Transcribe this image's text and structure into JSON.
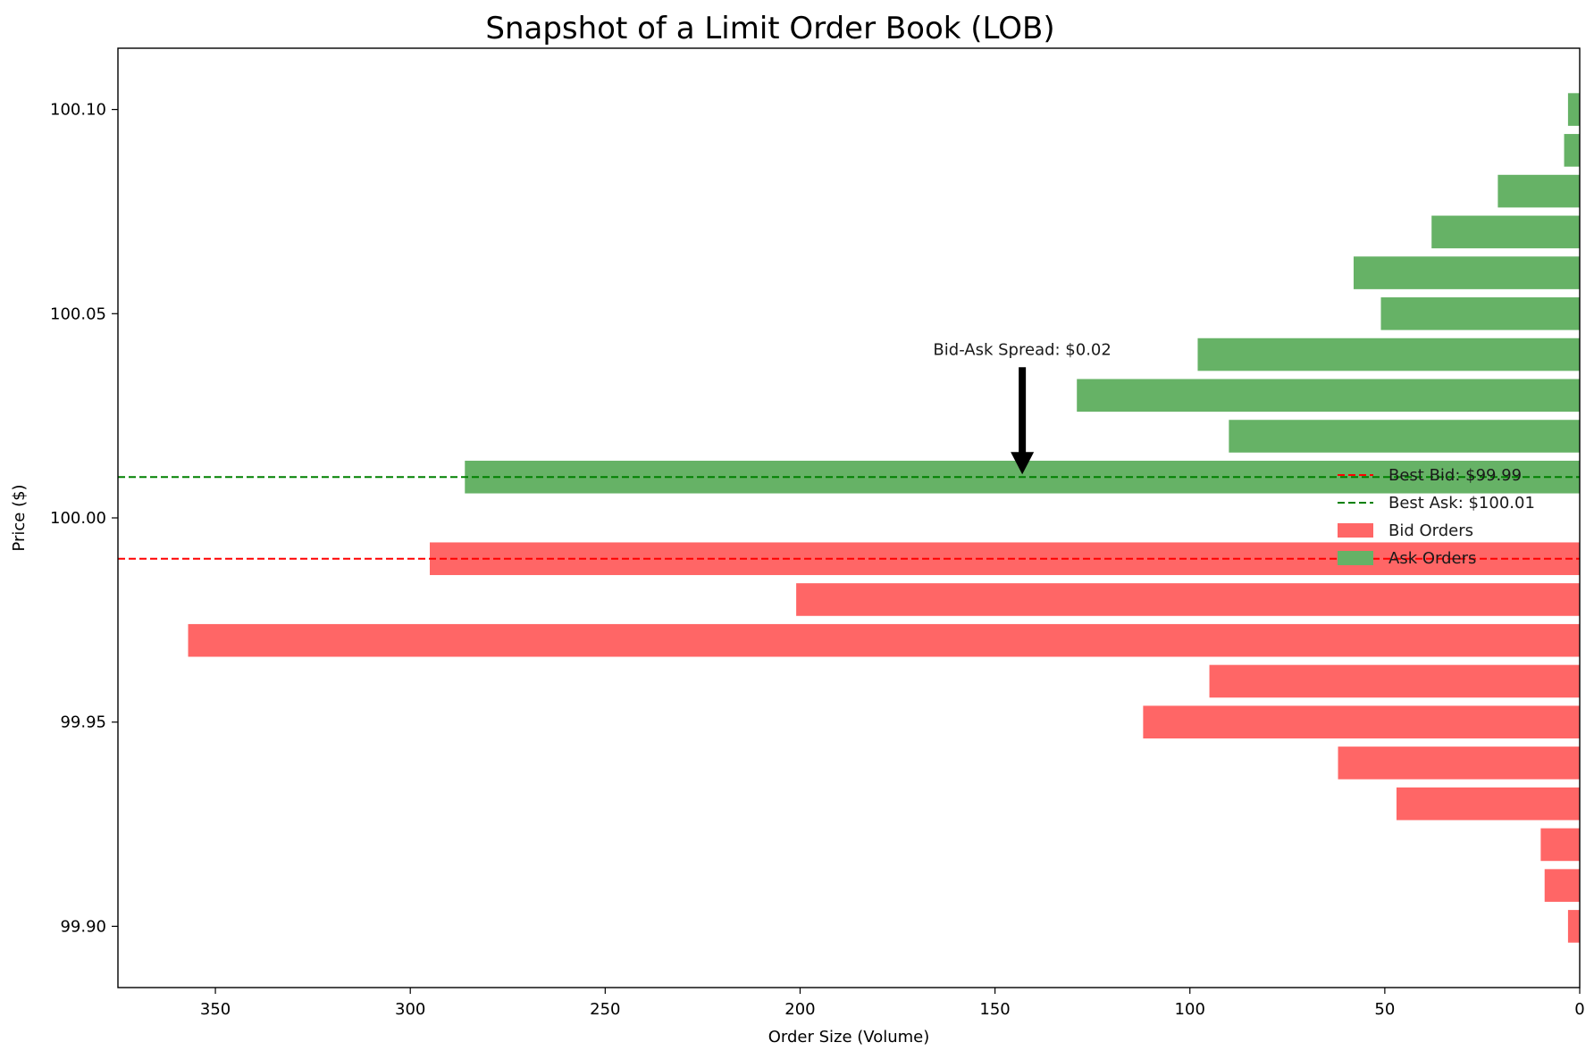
{
  "chart_data": {
    "type": "bar",
    "orientation": "horizontal",
    "title": "Snapshot of a Limit Order Book (LOB)",
    "xlabel": "Order Size (Volume)",
    "ylabel": "Price ($)",
    "xlim": [
      375,
      0
    ],
    "ylim": [
      99.885,
      100.115
    ],
    "x_inverted": true,
    "xticks": [
      350,
      300,
      250,
      200,
      150,
      100,
      50,
      0
    ],
    "yticks": [
      99.9,
      99.95,
      100.0,
      100.05,
      100.1
    ],
    "ytick_labels": [
      "99.90",
      "99.95",
      "100.00",
      "100.05",
      "100.10"
    ],
    "grid": false,
    "series": [
      {
        "name": "Bid Orders",
        "color": "#ff6666",
        "prices": [
          99.99,
          99.98,
          99.97,
          99.96,
          99.95,
          99.94,
          99.93,
          99.92,
          99.91,
          99.9
        ],
        "values": [
          295,
          201,
          357,
          95,
          112,
          62,
          47,
          10,
          9,
          3
        ]
      },
      {
        "name": "Ask Orders",
        "color": "#66b266",
        "prices": [
          100.01,
          100.02,
          100.03,
          100.04,
          100.05,
          100.06,
          100.07,
          100.08,
          100.09,
          100.1
        ],
        "values": [
          286,
          90,
          129,
          98,
          51,
          58,
          38,
          21,
          4,
          3
        ]
      }
    ],
    "reference_lines": [
      {
        "name": "Best Bid: $99.99",
        "price": 99.99,
        "color": "#ff0000",
        "style": "dashed"
      },
      {
        "name": "Best Ask: $100.01",
        "price": 100.01,
        "color": "#008000",
        "style": "dashed"
      }
    ],
    "annotation": {
      "text": "Bid-Ask Spread: $0.02",
      "x": 143,
      "y": 100.01
    },
    "legend": {
      "placement": "right",
      "entries": [
        "Best Bid: $99.99",
        "Best Ask: $100.01",
        "Bid Orders",
        "Ask Orders"
      ]
    }
  }
}
